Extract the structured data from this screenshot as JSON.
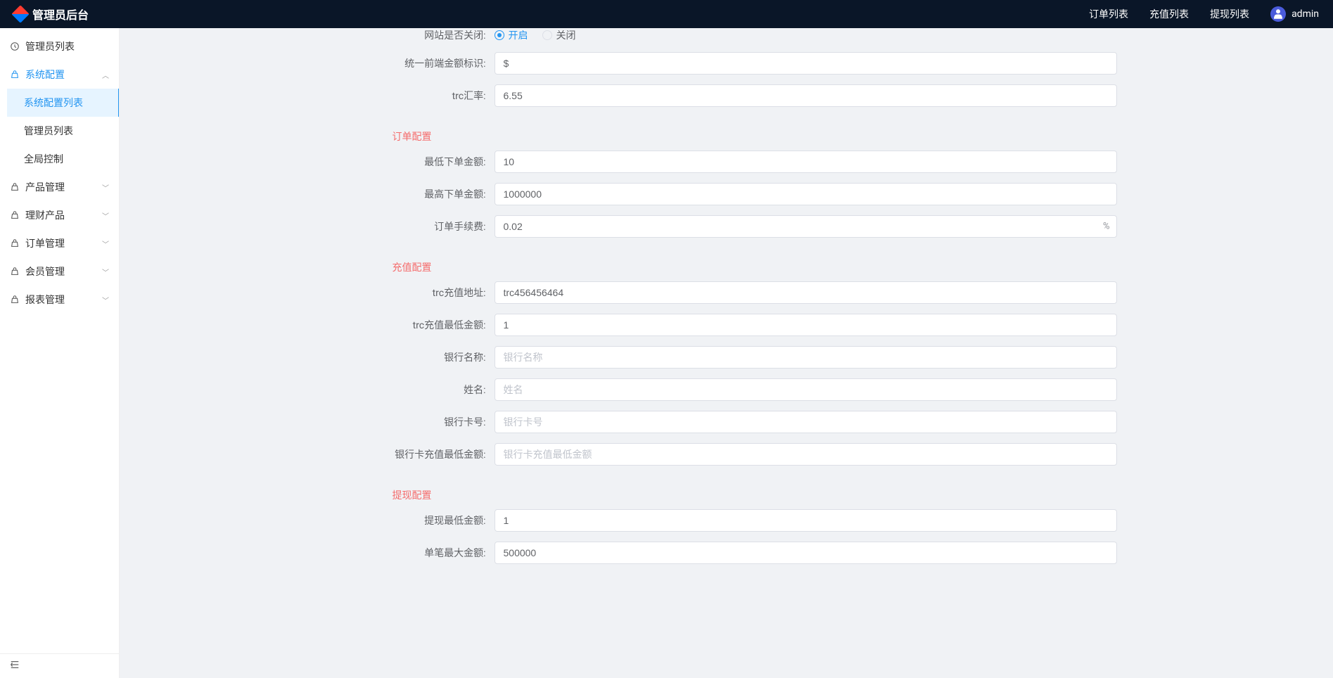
{
  "header": {
    "brand": "管理员后台",
    "nav": {
      "orders": "订单列表",
      "recharge": "充值列表",
      "withdraw": "提现列表"
    },
    "user": "admin"
  },
  "sidebar": {
    "admin_list": "管理员列表",
    "sys_config": "系统配置",
    "sub_config_list": "系统配置列表",
    "sub_admin_list": "管理员列表",
    "sub_global": "全局控制",
    "product_mgmt": "产品管理",
    "finance_product": "理财产品",
    "order_mgmt": "订单管理",
    "member_mgmt": "会员管理",
    "report_mgmt": "报表管理"
  },
  "form": {
    "site_closed": {
      "label": "网站是否关闭:",
      "open": "开启",
      "close": "关闭"
    },
    "currency_prefix": {
      "label": "统一前端金额标识:",
      "value": "$"
    },
    "trc_rate": {
      "label": "trc汇率:",
      "value": "6.55"
    },
    "section_order": "订单配置",
    "min_order": {
      "label": "最低下单金额:",
      "value": "10"
    },
    "max_order": {
      "label": "最高下单金额:",
      "value": "1000000"
    },
    "order_fee": {
      "label": "订单手续费:",
      "value": "0.02",
      "suffix": "%"
    },
    "section_recharge": "充值配置",
    "trc_addr": {
      "label": "trc充值地址:",
      "value": "trc456456464"
    },
    "trc_min": {
      "label": "trc充值最低金额:",
      "value": "1"
    },
    "bank_name": {
      "label": "银行名称:",
      "placeholder": "银行名称"
    },
    "name": {
      "label": "姓名:",
      "placeholder": "姓名"
    },
    "bank_card": {
      "label": "银行卡号:",
      "placeholder": "银行卡号"
    },
    "bank_min": {
      "label": "银行卡充值最低金额:",
      "placeholder": "银行卡充值最低金额"
    },
    "section_withdraw": "提现配置",
    "withdraw_min": {
      "label": "提现最低金额:",
      "value": "1"
    },
    "withdraw_max": {
      "label": "单笔最大金额:",
      "value": "500000"
    }
  }
}
